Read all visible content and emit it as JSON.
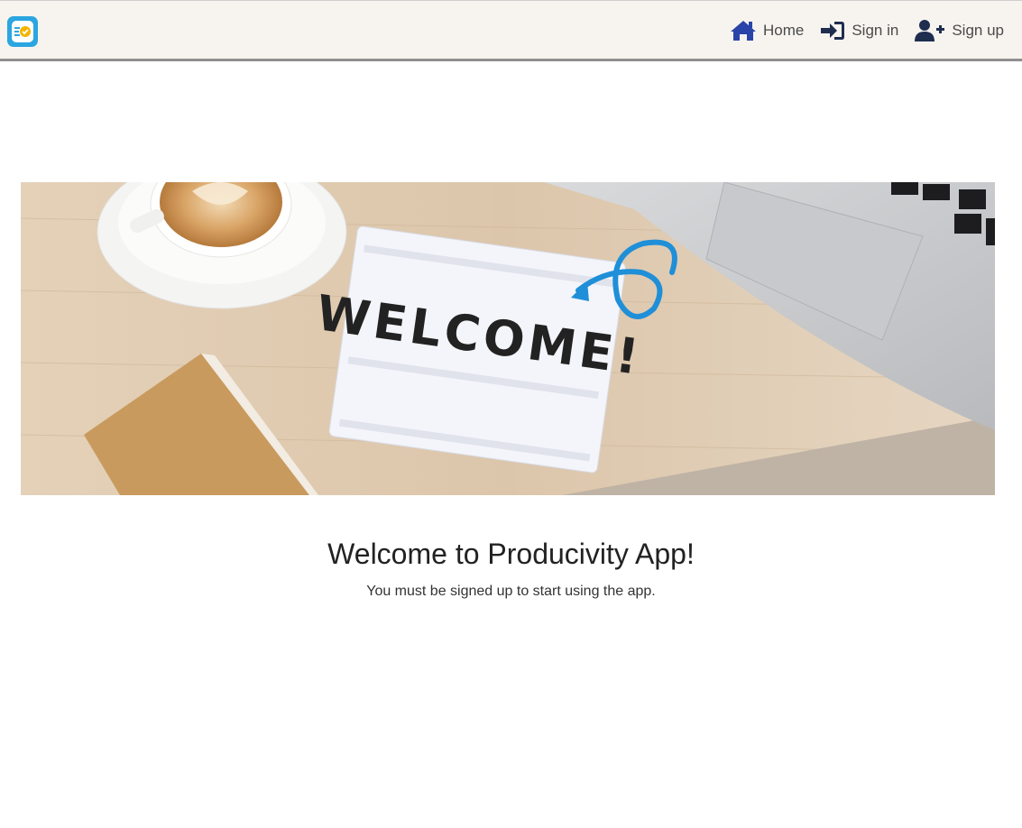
{
  "navbar": {
    "logo_icon": "checklist-app-icon",
    "links": [
      {
        "label": "Home",
        "icon": "home-icon"
      },
      {
        "label": "Sign in",
        "icon": "sign-in-icon"
      },
      {
        "label": "Sign up",
        "icon": "user-plus-icon"
      }
    ],
    "colors": {
      "background": "#f7f4ef",
      "icon": "#1e3a8a",
      "text": "#4a4a4a"
    }
  },
  "hero": {
    "lightbox_text": "WELCOME!"
  },
  "main": {
    "title": "Welcome to Producivity App!",
    "subtitle": "You must be signed up to start using the app."
  }
}
